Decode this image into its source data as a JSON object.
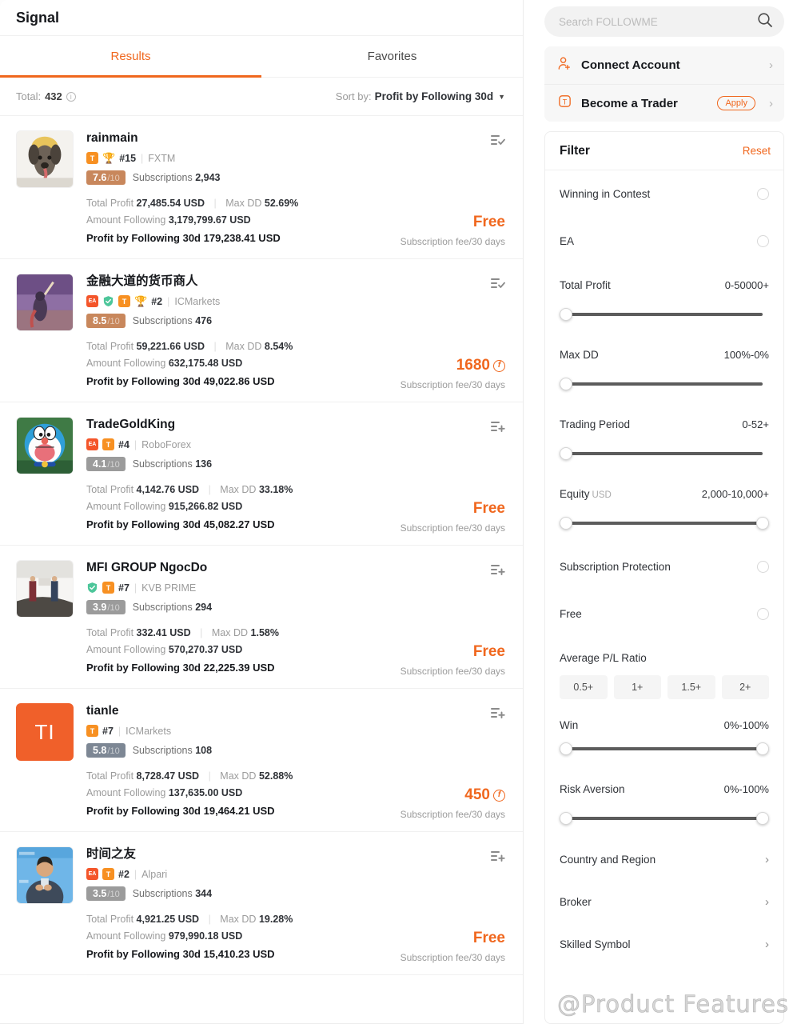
{
  "left": {
    "title": "Signal",
    "tabs": [
      {
        "label": "Results",
        "active": true
      },
      {
        "label": "Favorites",
        "active": false
      }
    ],
    "total_label": "Total:",
    "total_value": "432",
    "sort_label": "Sort by:",
    "sort_value": "Profit by Following 30d",
    "stat_labels": {
      "total_profit": "Total Profit",
      "max_dd": "Max DD",
      "amount_following": "Amount Following",
      "profit_following": "Profit by Following 30d",
      "subscriptions": "Subscriptions",
      "fee_note": "Subscription fee/30 days"
    },
    "cards": [
      {
        "name": "rainmain",
        "avatar_type": "photo-dog",
        "badges": [
          "T",
          "trophy"
        ],
        "rank": "#15",
        "broker": "FXTM",
        "score": "7.6",
        "score_den": "/10",
        "score_tone": "hi",
        "subscriptions": "2,943",
        "total_profit": "27,485.54 USD",
        "max_dd": "52.69%",
        "amount_following": "3,179,799.67 USD",
        "profit_following": "179,238.41 USD",
        "price": "Free",
        "price_is_coin": false,
        "action_icon": "list-check-icon"
      },
      {
        "name": "金融大道的货币商人",
        "avatar_type": "photo-purple",
        "badges": [
          "EA",
          "shield",
          "T",
          "trophy"
        ],
        "rank": "#2",
        "broker": "ICMarkets",
        "score": "8.5",
        "score_den": "/10",
        "score_tone": "hi",
        "subscriptions": "476",
        "total_profit": "59,221.66 USD",
        "max_dd": "8.54%",
        "amount_following": "632,175.48 USD",
        "profit_following": "49,022.86 USD",
        "price": "1680",
        "price_is_coin": true,
        "action_icon": "list-check-icon"
      },
      {
        "name": "TradeGoldKing",
        "avatar_type": "photo-doraemon",
        "badges": [
          "EA",
          "T"
        ],
        "rank": "#4",
        "broker": "RoboForex",
        "score": "4.1",
        "score_den": "/10",
        "score_tone": "md",
        "subscriptions": "136",
        "total_profit": "4,142.76 USD",
        "max_dd": "33.18%",
        "amount_following": "915,266.82 USD",
        "profit_following": "45,082.27 USD",
        "price": "Free",
        "price_is_coin": false,
        "action_icon": "list-add-icon"
      },
      {
        "name": "MFI GROUP NgocDo",
        "avatar_type": "photo-office",
        "badges": [
          "shield",
          "T"
        ],
        "rank": "#7",
        "broker": "KVB PRIME",
        "score": "3.9",
        "score_den": "/10",
        "score_tone": "md",
        "subscriptions": "294",
        "total_profit": "332.41 USD",
        "max_dd": "1.58%",
        "amount_following": "570,270.37 USD",
        "profit_following": "22,225.39 USD",
        "price": "Free",
        "price_is_coin": false,
        "action_icon": "list-add-icon"
      },
      {
        "name": "tianle",
        "avatar_type": "initials",
        "avatar_initials": "TI",
        "badges": [
          "T"
        ],
        "rank": "#7",
        "broker": "ICMarkets",
        "score": "5.8",
        "score_den": "/10",
        "score_tone": "bl",
        "subscriptions": "108",
        "total_profit": "8,728.47 USD",
        "max_dd": "52.88%",
        "amount_following": "137,635.00 USD",
        "profit_following": "19,464.21 USD",
        "price": "450",
        "price_is_coin": true,
        "action_icon": "list-add-icon"
      },
      {
        "name": "时间之友",
        "avatar_type": "photo-speaker",
        "badges": [
          "EA",
          "T"
        ],
        "rank": "#2",
        "broker": "Alpari",
        "score": "3.5",
        "score_den": "/10",
        "score_tone": "md",
        "subscriptions": "344",
        "total_profit": "4,921.25 USD",
        "max_dd": "19.28%",
        "amount_following": "979,990.18 USD",
        "profit_following": "15,410.23 USD",
        "price": "Free",
        "price_is_coin": false,
        "action_icon": "list-add-icon"
      }
    ]
  },
  "right": {
    "search_placeholder": "Search FOLLOWME",
    "quick_actions": [
      {
        "label": "Connect Account",
        "icon": "user-add-icon",
        "pill": ""
      },
      {
        "label": "Become a Trader",
        "icon": "trader-t-icon",
        "pill": "Apply"
      }
    ],
    "filter": {
      "title": "Filter",
      "reset": "Reset",
      "winning_in_contest": "Winning in Contest",
      "ea": "EA",
      "total_profit_label": "Total Profit",
      "total_profit_value": "0-50000+",
      "max_dd_label": "Max DD",
      "max_dd_value": "100%-0%",
      "trading_period_label": "Trading Period",
      "trading_period_value": "0-52+",
      "equity_label": "Equity",
      "equity_unit": "USD",
      "equity_value": "2,000-10,000+",
      "subscription_protection": "Subscription Protection",
      "free": "Free",
      "avg_pl_label": "Average P/L Ratio",
      "avg_pl_options": [
        "0.5+",
        "1+",
        "1.5+",
        "2+"
      ],
      "win_label": "Win",
      "win_value": "0%-100%",
      "risk_aversion_label": "Risk Aversion",
      "risk_aversion_value": "0%-100%",
      "country_region": "Country and Region",
      "broker": "Broker",
      "skilled_symbol": "Skilled Symbol"
    }
  },
  "watermark": "@Product Features",
  "colors": {
    "accent": "#f0671e",
    "text": "#16181c",
    "muted": "#9b9b9b"
  }
}
